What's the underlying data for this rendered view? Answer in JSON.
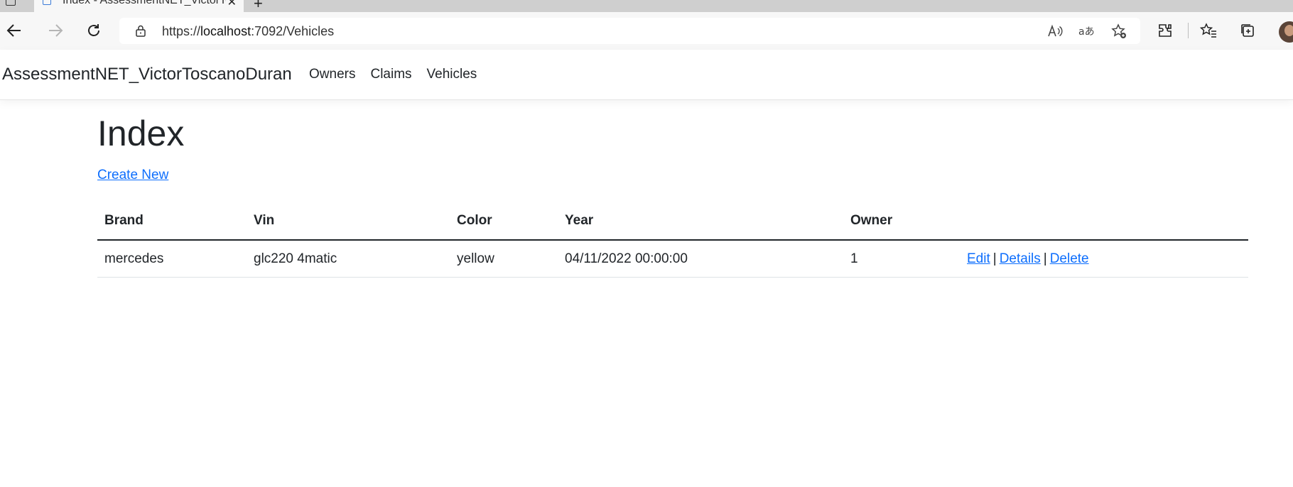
{
  "browser": {
    "tab_title": "Index - AssessmentNET_VictorToscanoDuran",
    "url_scheme": "https://",
    "url_host": "localhost",
    "url_rest": ":7092/Vehicles"
  },
  "navbar": {
    "brand": "AssessmentNET_VictorToscanoDuran",
    "links": [
      "Owners",
      "Claims",
      "Vehicles"
    ]
  },
  "page": {
    "title": "Index",
    "create_new": "Create New"
  },
  "table": {
    "headers": [
      "Brand",
      "Vin",
      "Color",
      "Year",
      "Owner",
      ""
    ],
    "rows": [
      {
        "brand": "mercedes",
        "vin": "glc220 4matic",
        "color": "yellow",
        "year": "04/11/2022 00:00:00",
        "owner": "1"
      }
    ],
    "actions": {
      "edit": "Edit",
      "details": "Details",
      "delete": "Delete",
      "separator": "|"
    }
  }
}
